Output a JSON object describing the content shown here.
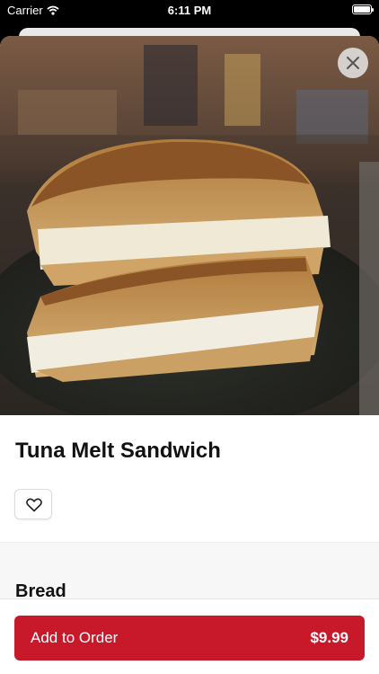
{
  "status_bar": {
    "carrier": "Carrier",
    "time": "6:11 PM",
    "wifi_icon": "wifi-icon",
    "battery_icon": "battery-icon"
  },
  "product": {
    "image_name": "tuna-melt-sandwich-photo",
    "title": "Tuna Melt Sandwich",
    "favorite_icon": "heart-icon",
    "close_icon": "close-icon"
  },
  "sections": [
    {
      "title": "Bread"
    }
  ],
  "order": {
    "label": "Add to Order",
    "price": "$9.99"
  },
  "colors": {
    "accent": "#c8192a"
  }
}
